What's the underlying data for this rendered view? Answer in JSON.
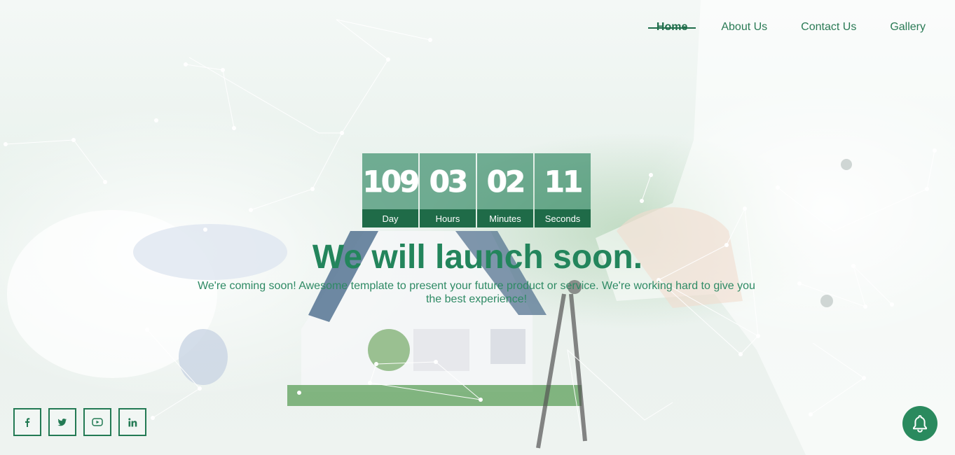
{
  "nav": {
    "items": [
      {
        "label": "Home",
        "active": true
      },
      {
        "label": "About Us",
        "active": false
      },
      {
        "label": "Contact Us",
        "active": false
      },
      {
        "label": "Gallery",
        "active": false
      }
    ]
  },
  "countdown": {
    "units": [
      {
        "value": "109",
        "label": "Day"
      },
      {
        "value": "03",
        "label": "Hours"
      },
      {
        "value": "02",
        "label": "Minutes"
      },
      {
        "value": "11",
        "label": "Seconds"
      }
    ]
  },
  "hero": {
    "headline": "We will launch soon.",
    "subtext": "We're coming soon! Awesome template to present your future product or service. We're working hard to give you the best experience!"
  },
  "social": {
    "icons": [
      {
        "name": "facebook-icon",
        "glyph": "f"
      },
      {
        "name": "twitter-icon",
        "glyph": "🐦"
      },
      {
        "name": "youtube-icon",
        "glyph": "▶"
      },
      {
        "name": "linkedin-icon",
        "glyph": "in"
      }
    ]
  },
  "notify": {
    "icon": "bell-icon"
  },
  "colors": {
    "accent": "#23855c",
    "dark_accent": "#1f6b48"
  }
}
